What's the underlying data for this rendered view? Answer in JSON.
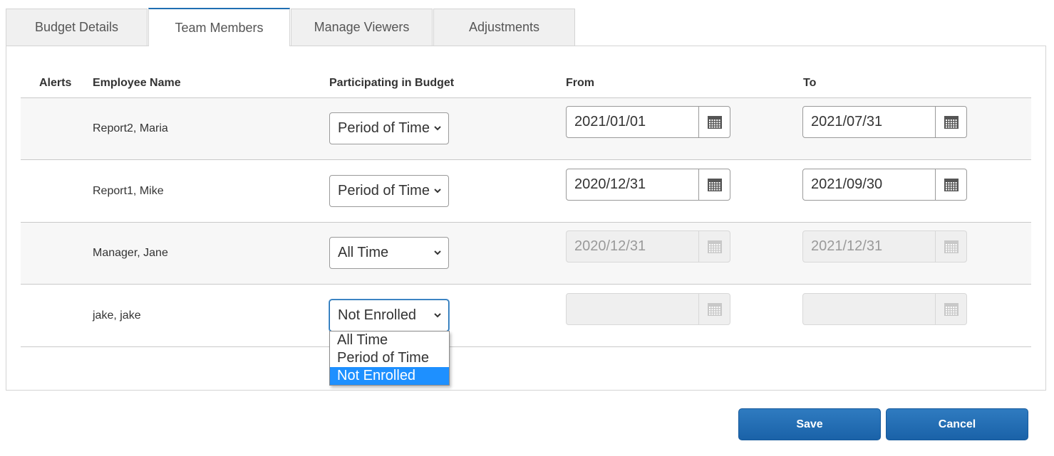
{
  "tabs": [
    {
      "label": "Budget Details",
      "active": false
    },
    {
      "label": "Team Members",
      "active": true
    },
    {
      "label": "Manage Viewers",
      "active": false
    },
    {
      "label": "Adjustments",
      "active": false
    }
  ],
  "table": {
    "headers": {
      "alerts": "Alerts",
      "employee": "Employee Name",
      "participating": "Participating in Budget",
      "from": "From",
      "to": "To"
    },
    "rows": [
      {
        "name": "Report2, Maria",
        "participation": "Period of Time",
        "from": "2021/01/01",
        "to": "2021/07/31",
        "dates_enabled": true
      },
      {
        "name": "Report1, Mike",
        "participation": "Period of Time",
        "from": "2020/12/31",
        "to": "2021/09/30",
        "dates_enabled": true
      },
      {
        "name": "Manager, Jane",
        "participation": "All Time",
        "from": "2020/12/31",
        "to": "2021/12/31",
        "dates_enabled": false
      },
      {
        "name": "jake, jake",
        "participation": "Not Enrolled",
        "from": "",
        "to": "",
        "dates_enabled": false
      }
    ]
  },
  "dropdown": {
    "options": [
      "All Time",
      "Period of Time",
      "Not Enrolled"
    ],
    "selected": "Not Enrolled"
  },
  "buttons": {
    "save": "Save",
    "cancel": "Cancel"
  },
  "icons": {
    "calendar": "calendar-icon",
    "select_arrow": "chevron-down-icon"
  },
  "colors": {
    "accent": "#1f6fb2",
    "button": "#1a62a8",
    "option_highlight": "#1e90ff",
    "disabled_field": "#efefef"
  }
}
